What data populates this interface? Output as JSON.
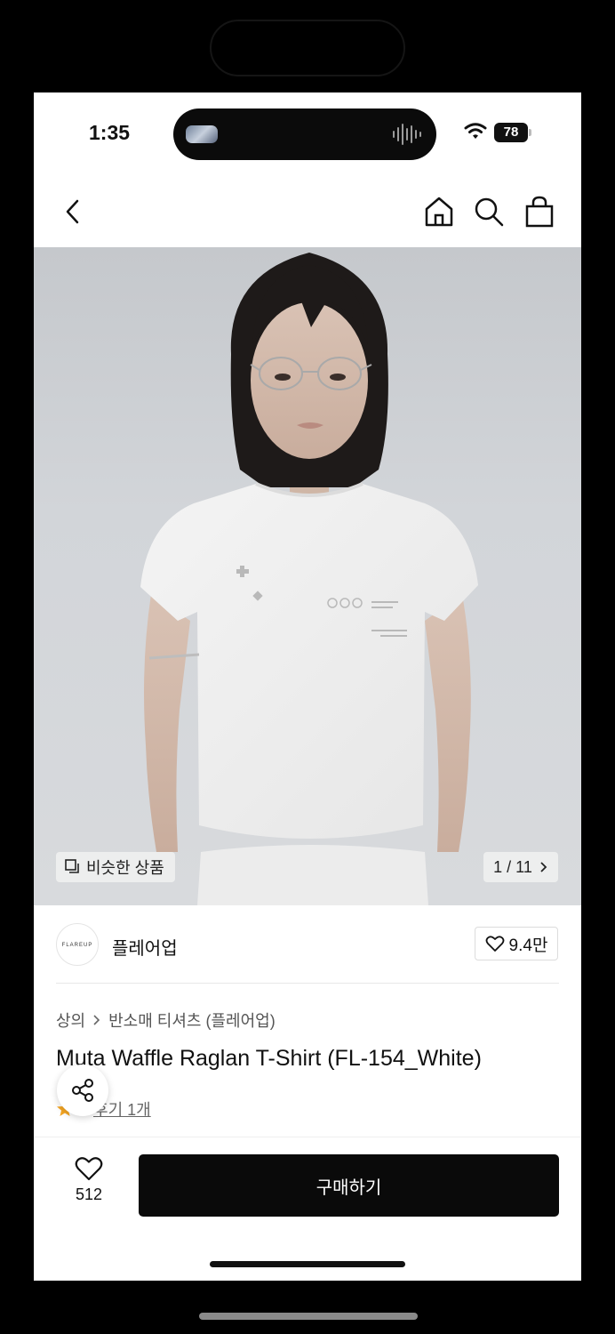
{
  "status_bar": {
    "time": "1:35",
    "battery": "78"
  },
  "hero": {
    "similar_label": "비슷한 상품",
    "page_indicator": "1 / 11"
  },
  "brand": {
    "logo_text": "FLAREUP",
    "name": "플레어업",
    "likes": "9.4만"
  },
  "breadcrumb": {
    "category": "상의",
    "subcategory": "반소매 티셔츠 (플레어업)"
  },
  "product": {
    "title": "Muta Waffle Raglan T-Shirt (FL-154_White)",
    "rating": "5",
    "review_link": "후기 1개"
  },
  "bottom_bar": {
    "wish_count": "512",
    "buy_label": "구매하기"
  },
  "colors": {
    "buy_button": "#0a0a0a",
    "star": "#f5a623",
    "page_bg": "#000000"
  }
}
